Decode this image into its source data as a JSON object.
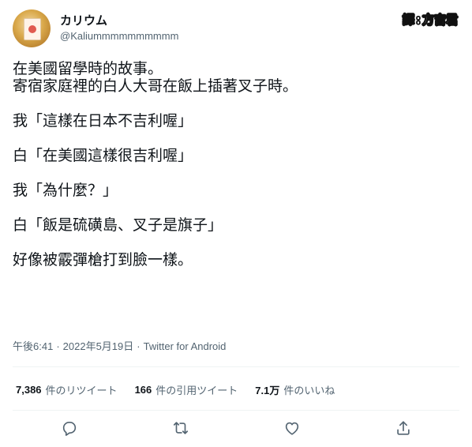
{
  "tweet": {
    "display_name": "カリウム",
    "handle": "@Kaliummmmmmmmmm",
    "watermark": {
      "part1": "譯",
      "separator": ":",
      "part2": "方吉君"
    },
    "lines": [
      "在美國留學時的故事。",
      "寄宿家庭裡的白人大哥在飯上插著叉子時。",
      "",
      "我「這樣在日本不吉利喔」",
      "",
      "白「在美國這樣很吉利喔」",
      "",
      "我「為什麼？」",
      "",
      "白「飯是硫磺島、叉子是旗子」",
      "",
      "好像被霰彈槍打到臉一樣。"
    ],
    "time": "午後6:41",
    "date": "2022年5月19日",
    "source": "Twitter for Android",
    "meta_separator": "·",
    "stats": {
      "retweets_count": "7,386",
      "retweets_label": "件のリツイート",
      "quotes_count": "166",
      "quotes_label": "件の引用ツイート",
      "likes_count": "7.1万",
      "likes_label": "件のいいね"
    },
    "icons": {
      "reply": "reply-icon",
      "retweet": "retweet-icon",
      "like": "like-icon",
      "share": "share-icon"
    }
  }
}
